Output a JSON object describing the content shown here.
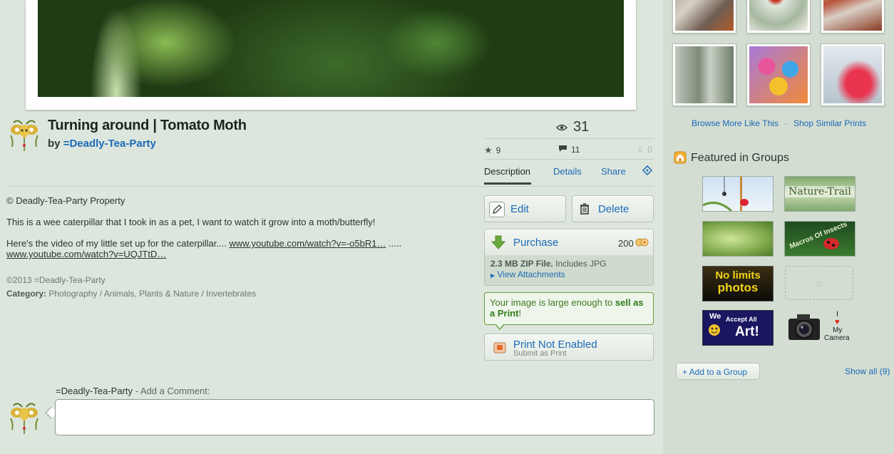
{
  "artwork": {
    "title": "Turning around | Tomato Moth",
    "by_prefix": "by ",
    "author": "=Deadly-Tea-Party"
  },
  "stats": {
    "views": "31",
    "favourites": "9",
    "comments": "11",
    "downloads": "0"
  },
  "tabs": {
    "description": "Description",
    "details": "Details",
    "share": "Share"
  },
  "description": {
    "property": "© Deadly-Tea-Party Property",
    "line1": "This is a wee caterpillar that I took in as a pet, I want to watch it grow into a moth/butterfly!",
    "line2_prefix": "Here's the video of my little set up for the caterpillar.... ",
    "link1": "www.youtube.com/watch?v=-o5bR1…",
    "line2_mid": " ..... ",
    "link2": "www.youtube.com/watch?v=UQJTtD…",
    "copyright": "©2013 =Deadly-Tea-Party",
    "category_label": "Category:",
    "category": "Photography / Animals, Plants & Nature / Invertebrates"
  },
  "actions": {
    "edit": "Edit",
    "delete": "Delete",
    "purchase": "Purchase",
    "purchase_price": "200",
    "zip_bold": "2.3 MB ZIP File.",
    "zip_rest": " Includes JPG",
    "view_attachments": "View Attachments",
    "notice_prefix": "Your image is large enough to ",
    "notice_bold": "sell as a Print",
    "notice_suffix": "!",
    "print_title": "Print Not Enabled",
    "print_sub": "Submit as Print"
  },
  "comment": {
    "user": "=Deadly-Tea-Party",
    "add_label": " - Add a Comment:"
  },
  "sidebar": {
    "browse_more": "Browse More Like This",
    "separator": "·",
    "shop_similar": "Shop Similar Prints",
    "featured_title": "Featured in Groups",
    "add_group": "+  Add to a Group",
    "show_all": "Show all (9)",
    "group_badges": {
      "nature_trail": "Nature-Trail",
      "macros": "Macros Of Insects",
      "no_limits_1": "No limits",
      "no_limits_2": "photos",
      "we": "We",
      "accept_all": "Accept All",
      "art": "Art!",
      "i": "I",
      "my": "My",
      "camera": "Camera"
    }
  },
  "colors": {
    "link_blue": "#1b6ab8",
    "page_bg": "#dde6dc",
    "sidebar_bg": "#d3ddd2",
    "notice_green": "#5ea03a"
  }
}
